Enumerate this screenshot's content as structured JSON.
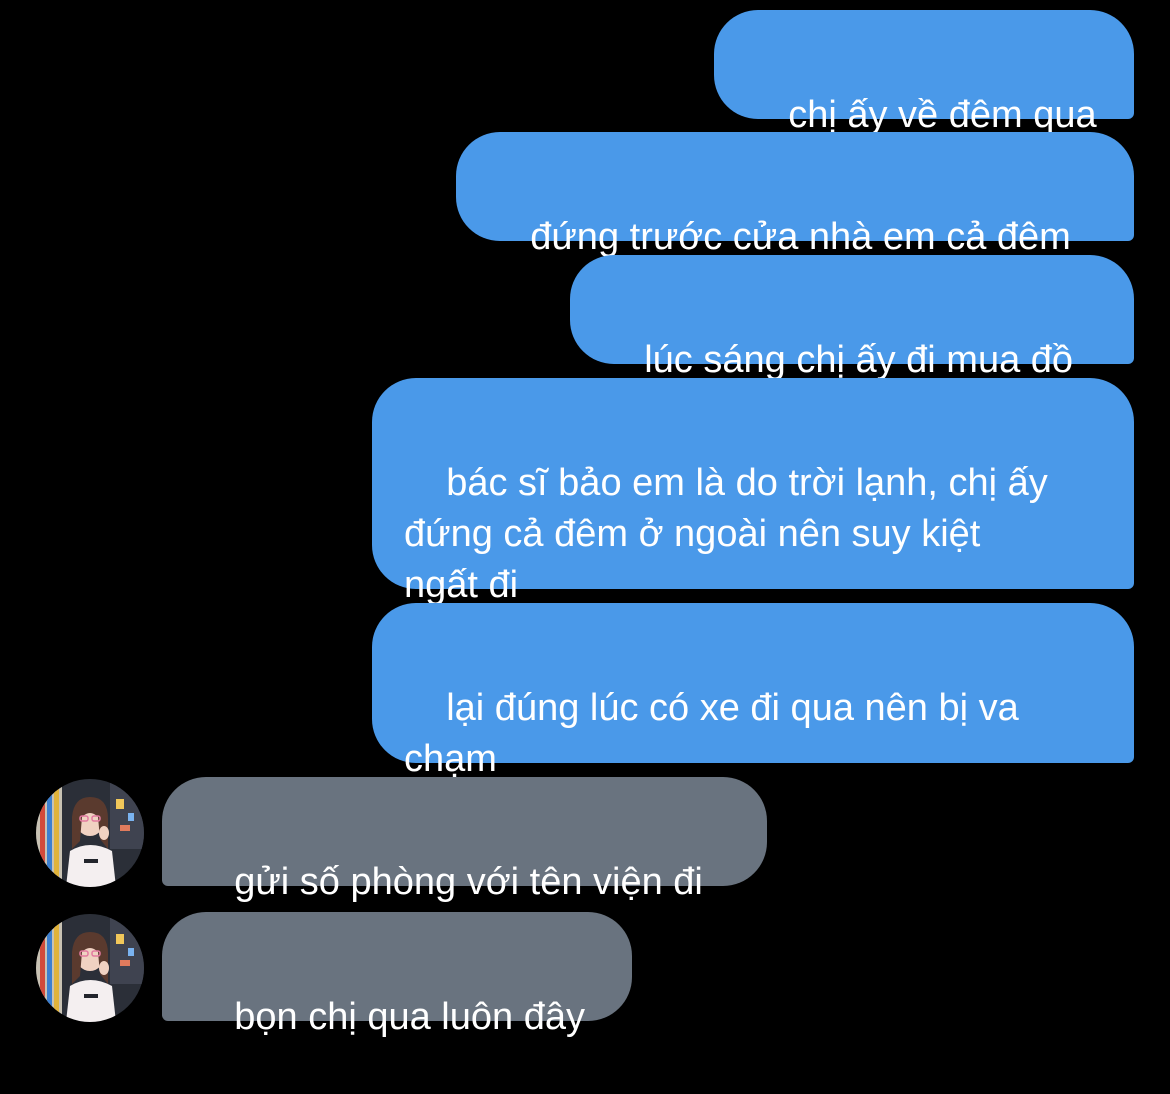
{
  "conversation": {
    "sent_messages": [
      "chị ấy về đêm qua",
      "đứng trước cửa nhà em cả đêm",
      "lúc sáng chị ấy đi mua đồ",
      "bác sĩ bảo em là do trời lạnh, chị ấy\nđứng cả đêm ở ngoài nên suy kiệt\nngất đi",
      "lại đúng lúc có xe đi qua nên bị va\nchạm"
    ],
    "received_messages": [
      "gửi số phòng với tên viện đi",
      "bọn chị qua luôn đây"
    ]
  },
  "colors": {
    "background": "#000000",
    "sent_bubble": "#4a99e9",
    "received_bubble": "#69737f",
    "text": "#ffffff"
  },
  "icons": {
    "contact_avatar": "contact-avatar-photo"
  }
}
